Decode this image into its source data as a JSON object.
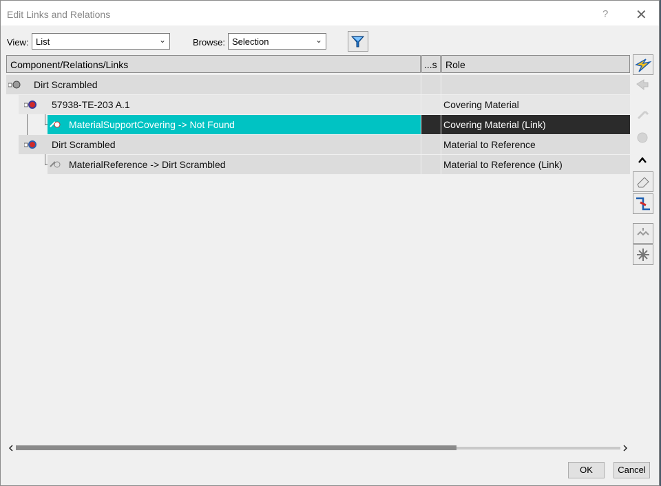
{
  "window": {
    "title": "Edit Links and Relations",
    "help": "?",
    "close": "✕"
  },
  "toolbar": {
    "view_label": "View:",
    "view_value": "List",
    "browse_label": "Browse:",
    "browse_value": "Selection"
  },
  "table": {
    "columns": [
      "Component/Relations/Links",
      "...s",
      "Role"
    ],
    "rows": [
      {
        "name": "Dirt Scrambled",
        "role": ""
      },
      {
        "name": "57938-TE-203 A.1",
        "role": "Covering Material"
      },
      {
        "name": "MaterialSupportCovering -> Not Found",
        "role": "Covering Material (Link)"
      },
      {
        "name": "Dirt Scrambled",
        "role": "Material to Reference"
      },
      {
        "name": "MaterialReference -> Dirt Scrambled",
        "role": "Material to Reference (Link)"
      }
    ]
  },
  "footer": {
    "ok": "OK",
    "cancel": "Cancel"
  },
  "colors": {
    "selection": "#00c3c3",
    "selection_dark": "#2b2b2b"
  }
}
